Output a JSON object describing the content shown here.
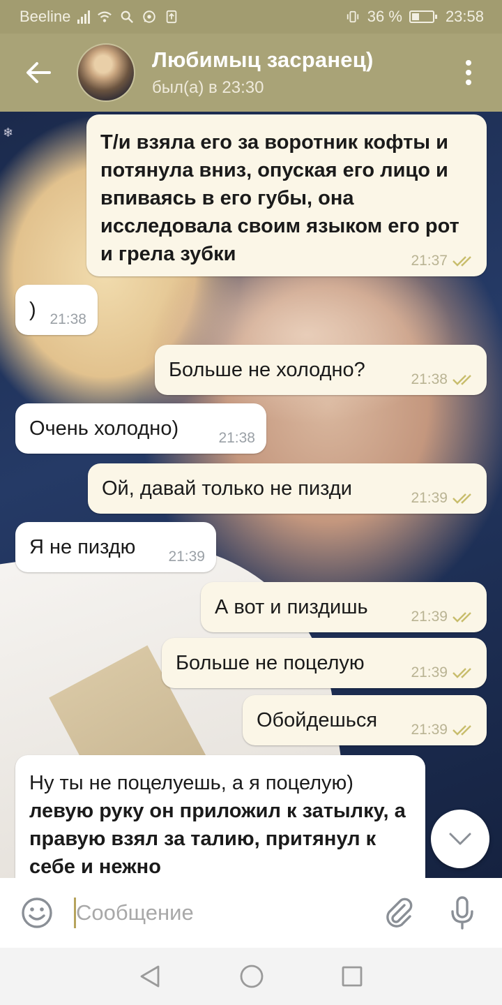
{
  "status_bar": {
    "carrier": "Beeline",
    "battery": "36 %",
    "time": "23:58"
  },
  "header": {
    "contact_name": "Любимыц засранец)",
    "contact_status": "был(а) в 23:30"
  },
  "messages": [
    {
      "direction": "out",
      "text": "Т/и взяла его за воротник кофты и потянула вниз, опуская его лицо и впиваясь в его губы, она исследовала своим языком его рот и грела зубки",
      "time": "21:37",
      "read": true
    },
    {
      "direction": "in",
      "text": ")",
      "time": "21:38"
    },
    {
      "direction": "out",
      "text": "Больше не холодно?",
      "time": "21:38",
      "read": true
    },
    {
      "direction": "in",
      "text": "Очень холодно)",
      "time": "21:38"
    },
    {
      "direction": "out",
      "text": "Ой, давай только не пизди",
      "time": "21:39",
      "read": true
    },
    {
      "direction": "in",
      "text": "Я не пиздю",
      "time": "21:39"
    },
    {
      "direction": "out",
      "text": "А вот и пиздишь",
      "time": "21:39",
      "read": true
    },
    {
      "direction": "out",
      "text": "Больше не поцелую",
      "time": "21:39",
      "read": true
    },
    {
      "direction": "out",
      "text": "Обойдешься",
      "time": "21:39",
      "read": true
    },
    {
      "direction": "in",
      "text": "Ну ты не поцелуешь, а я поцелую)",
      "text2": "левую руку он приложил к затылку, а правую взял за талию, притянул к себе и нежно"
    }
  ],
  "input": {
    "placeholder": "Сообщение"
  },
  "colors": {
    "header_bg": "#a9a377",
    "outgoing_bubble": "#fbf6e7",
    "incoming_bubble": "#ffffff",
    "read_checks": "#c8bd6c"
  }
}
